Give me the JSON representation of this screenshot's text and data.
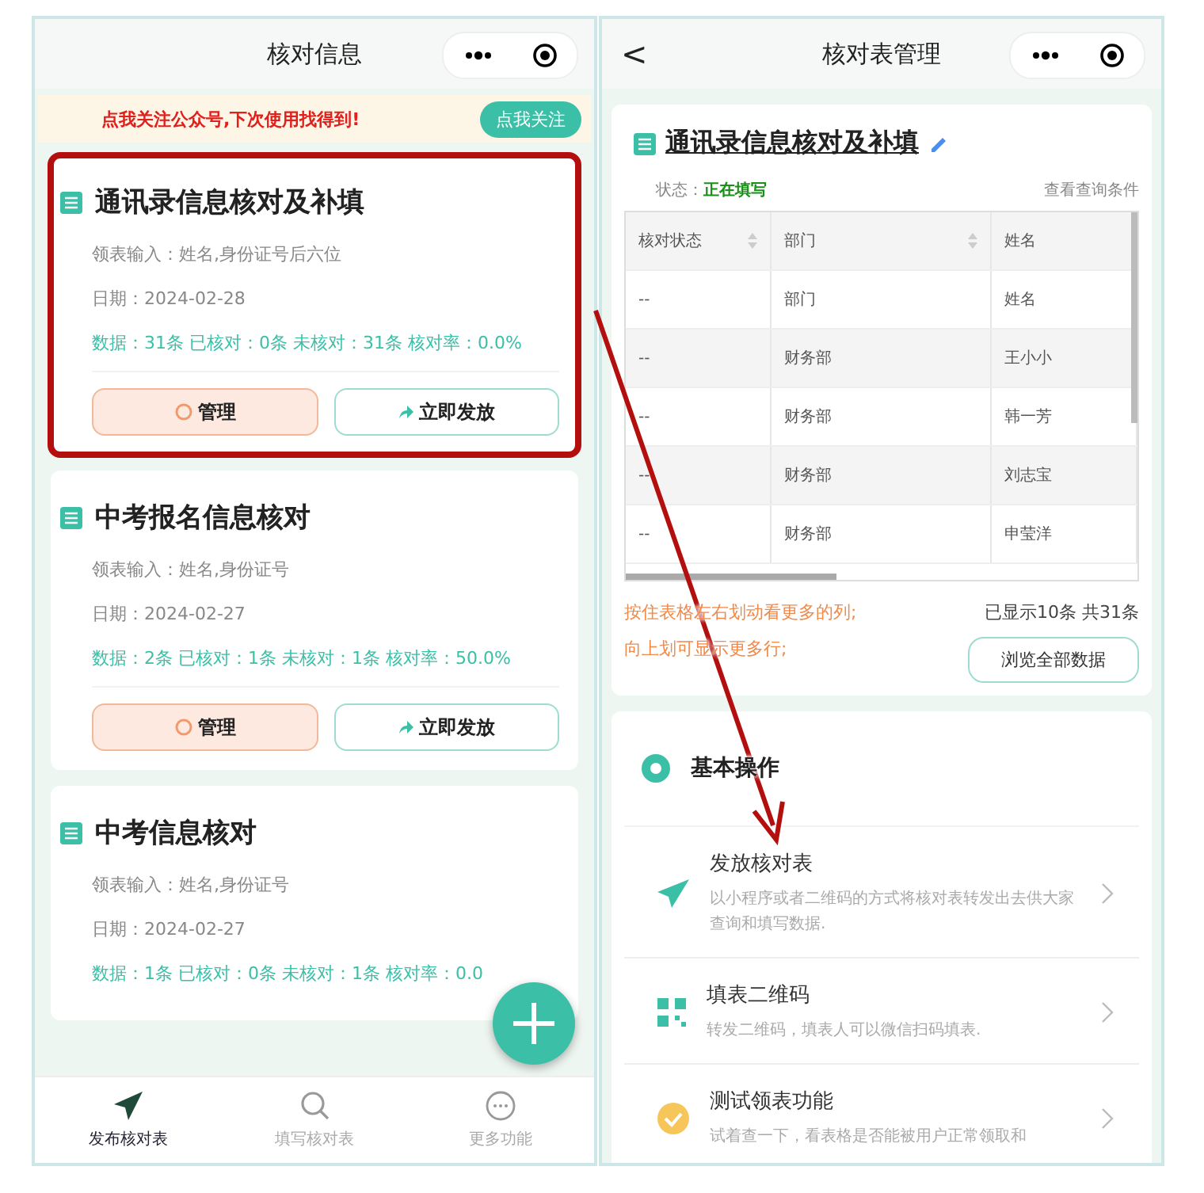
{
  "left_screen": {
    "title": "核对信息",
    "banner": {
      "text": "点我关注公众号,下次使用找得到!",
      "button": "点我关注"
    },
    "cards": [
      {
        "title": "通讯录信息核对及补填",
        "input": "领表输入：姓名,身份证号后六位",
        "date": "日期：2024-02-28",
        "stats": "数据：31条 已核对：0条 未核对：31条 核对率：0.0%",
        "manage": "管理",
        "publish": "立即发放",
        "highlighted": true
      },
      {
        "title": "中考报名信息核对",
        "input": "领表输入：姓名,身份证号",
        "date": "日期：2024-02-27",
        "stats": "数据：2条 已核对：1条 未核对：1条 核对率：50.0%",
        "manage": "管理",
        "publish": "立即发放",
        "highlighted": false
      },
      {
        "title": "中考信息核对",
        "input": "领表输入：姓名,身份证号",
        "date": "日期：2024-02-27",
        "stats": "数据：1条 已核对：0条 未核对：1条 核对率：0.0",
        "highlighted": false
      }
    ],
    "tabs": [
      {
        "label": "发布核对表",
        "selected": true
      },
      {
        "label": "填写核对表",
        "selected": false
      },
      {
        "label": "更多功能",
        "selected": false
      }
    ]
  },
  "right_screen": {
    "back": "<",
    "title": "核对表管理",
    "form_title": "通讯录信息核对及补填",
    "status_label": "状态：",
    "status": "正在填写",
    "query_link": "查看查询条件",
    "table": {
      "columns": [
        {
          "label": "核对状态",
          "sortable": true
        },
        {
          "label": "部门",
          "sortable": true
        },
        {
          "label": "姓名",
          "sortable": false
        }
      ],
      "rows": [
        [
          "--",
          "部门",
          "姓名"
        ],
        [
          "--",
          "财务部",
          "王小小"
        ],
        [
          "--",
          "财务部",
          "韩一芳"
        ],
        [
          "--",
          "财务部",
          "刘志宝"
        ],
        [
          "--",
          "财务部",
          "申莹洋"
        ]
      ]
    },
    "hints": [
      "按住表格左右划动看更多的列;",
      "向上划可显示更多行;"
    ],
    "count": "已显示10条 共31条",
    "browse_button": "浏览全部数据",
    "section_title": "基本操作",
    "actions": [
      {
        "title": "发放核对表",
        "desc": "以小程序或者二维码的方式将核对表转发出去供大家查询和填写数据."
      },
      {
        "title": "填表二维码",
        "desc": "转发二维码，填表人可以微信扫码填表."
      },
      {
        "title": "测试领表功能",
        "desc": "试着查一下，看表格是否能被用户正常领取和"
      }
    ]
  }
}
